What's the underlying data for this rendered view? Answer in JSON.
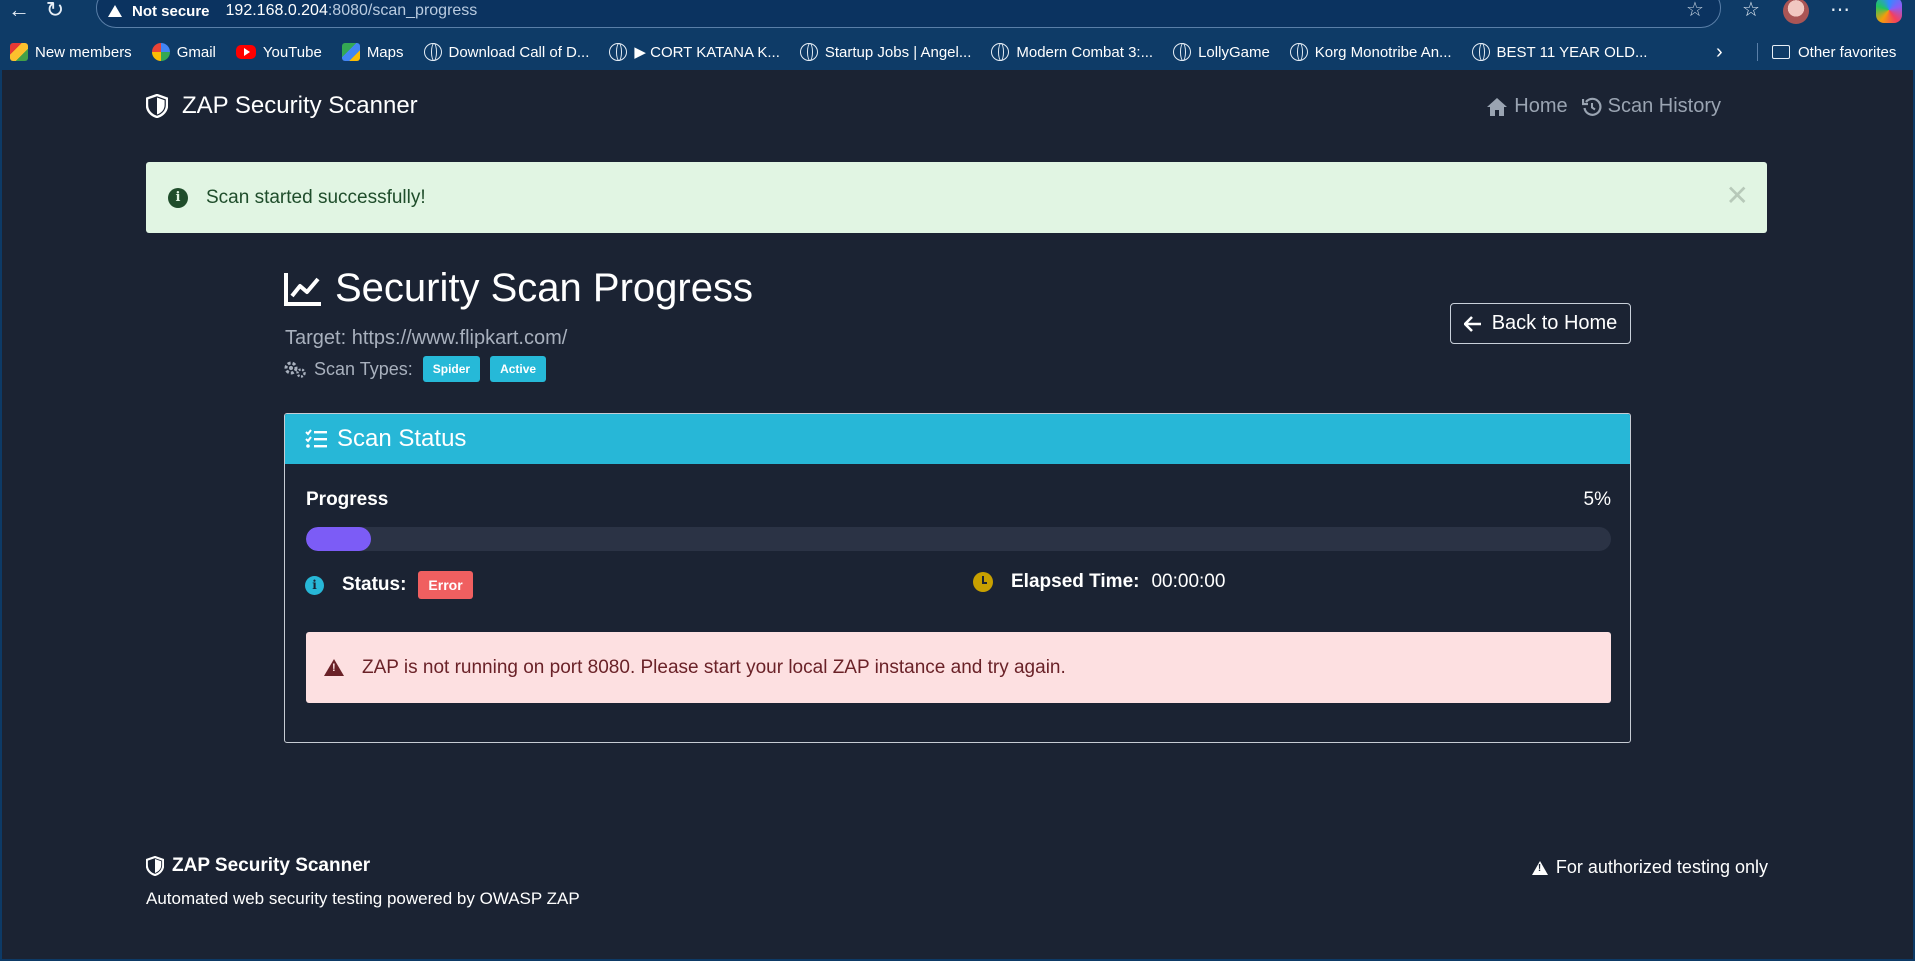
{
  "browser": {
    "security_label": "Not secure",
    "url_host": "192.168.0.204",
    "url_path": ":8080/scan_progress",
    "bookmarks": [
      {
        "label": "New members",
        "icon": "new-members-icon"
      },
      {
        "label": "Gmail",
        "icon": "google-icon"
      },
      {
        "label": "YouTube",
        "icon": "youtube-icon"
      },
      {
        "label": "Maps",
        "icon": "maps-icon"
      },
      {
        "label": "Download Call of D...",
        "icon": "globe-icon"
      },
      {
        "label": "▶ CORT KATANA K...",
        "icon": "globe-icon"
      },
      {
        "label": "Startup Jobs | Angel...",
        "icon": "globe-icon"
      },
      {
        "label": "Modern Combat 3:...",
        "icon": "globe-icon"
      },
      {
        "label": "LollyGame",
        "icon": "globe-icon"
      },
      {
        "label": "Korg Monotribe An...",
        "icon": "globe-icon"
      },
      {
        "label": "BEST 11 YEAR OLD...",
        "icon": "globe-icon"
      }
    ],
    "other_favorites": "Other favorites"
  },
  "navbar": {
    "brand": "ZAP Security Scanner",
    "home": "Home",
    "history": "Scan History"
  },
  "flash": {
    "message": "Scan started successfully!"
  },
  "page": {
    "title": "Security Scan Progress",
    "target": "Target: https://www.flipkart.com/",
    "scan_types_label": "Scan Types:",
    "scan_types": [
      "Spider",
      "Active"
    ],
    "back_button": "Back to Home"
  },
  "status_card": {
    "header": "Scan Status",
    "progress_label": "Progress",
    "progress_percent": 5,
    "progress_text": "5%",
    "status_label": "Status:",
    "status_value": "Error",
    "elapsed_label": "Elapsed Time:",
    "elapsed_value": "00:00:00",
    "error_message": "ZAP is not running on port 8080. Please start your local ZAP instance and try again."
  },
  "footer": {
    "brand": "ZAP Security Scanner",
    "tagline": "Automated web security testing powered by OWASP ZAP",
    "warning": "For authorized testing only"
  },
  "colors": {
    "app_bg": "#1b2333",
    "accent": "#27b7d7",
    "progress": "#7c5cf6",
    "danger": "#f05f60",
    "success_bg": "#e1f5e3",
    "danger_bg": "#fde0e1"
  }
}
